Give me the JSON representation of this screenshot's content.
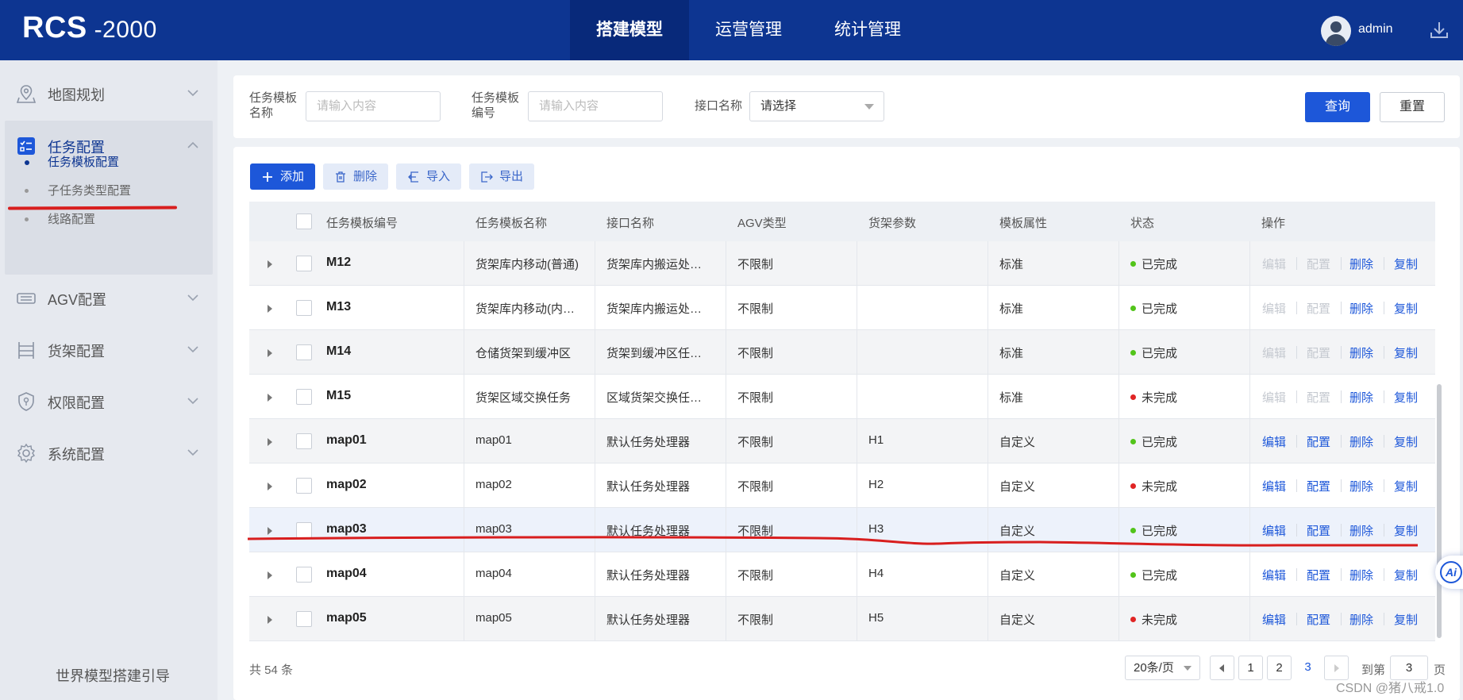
{
  "header": {
    "logo_main": "RCS",
    "logo_suffix": " -2000",
    "tabs": [
      {
        "label": "搭建模型",
        "active": true
      },
      {
        "label": "运营管理",
        "active": false
      },
      {
        "label": "统计管理",
        "active": false
      }
    ],
    "username": "admin",
    "download_icon": "download-icon"
  },
  "sidebar": {
    "items": [
      {
        "label": "地图规划",
        "icon": "map-pin-icon"
      },
      {
        "label": "任务配置",
        "icon": "task-list-icon",
        "expanded": true
      },
      {
        "label": "AGV配置",
        "icon": "agv-icon"
      },
      {
        "label": "货架配置",
        "icon": "shelf-icon"
      },
      {
        "label": "权限配置",
        "icon": "shield-icon"
      },
      {
        "label": "系统配置",
        "icon": "gear-icon"
      }
    ],
    "sub_items": [
      {
        "label": "任务模板配置",
        "active": true
      },
      {
        "label": "子任务类型配置",
        "active": false
      },
      {
        "label": "线路配置",
        "active": false
      }
    ],
    "footer": "世界模型搭建引导"
  },
  "search": {
    "template_name_label_1": "任务模板",
    "template_name_label_2": "名称",
    "template_name_placeholder": "请输入内容",
    "template_code_label_1": "任务模板",
    "template_code_label_2": "编号",
    "template_code_placeholder": "请输入内容",
    "interface_label": "接口名称",
    "interface_value": "请选择",
    "query_label": "查询",
    "reset_label": "重置"
  },
  "toolbar": {
    "add_label": "添加",
    "delete_label": "删除",
    "import_label": "导入",
    "export_label": "导出"
  },
  "table": {
    "columns": [
      "任务模板编号",
      "任务模板名称",
      "接口名称",
      "AGV类型",
      "货架参数",
      "模板属性",
      "状态",
      "操作"
    ],
    "actions": [
      "编辑",
      "配置",
      "删除",
      "复制"
    ],
    "rows": [
      {
        "code": "M12",
        "name": "货架库内移动(普通)",
        "interface": "货架库内搬运处…",
        "agv": "不限制",
        "shelf": "",
        "attr": "标准",
        "status": "已完成",
        "status_color": "#52c41a",
        "editable": false
      },
      {
        "code": "M13",
        "name": "货架库内移动(内…",
        "interface": "货架库内搬运处…",
        "agv": "不限制",
        "shelf": "",
        "attr": "标准",
        "status": "已完成",
        "status_color": "#52c41a",
        "editable": false
      },
      {
        "code": "M14",
        "name": "仓储货架到缓冲区",
        "interface": "货架到缓冲区任…",
        "agv": "不限制",
        "shelf": "",
        "attr": "标准",
        "status": "已完成",
        "status_color": "#52c41a",
        "editable": false
      },
      {
        "code": "M15",
        "name": "货架区域交换任务",
        "interface": "区域货架交换任…",
        "agv": "不限制",
        "shelf": "",
        "attr": "标准",
        "status": "未完成",
        "status_color": "#e02424",
        "editable": false
      },
      {
        "code": "map01",
        "name": "map01",
        "interface": "默认任务处理器",
        "agv": "不限制",
        "shelf": "H1",
        "attr": "自定义",
        "status": "已完成",
        "status_color": "#52c41a",
        "editable": true
      },
      {
        "code": "map02",
        "name": "map02",
        "interface": "默认任务处理器",
        "agv": "不限制",
        "shelf": "H2",
        "attr": "自定义",
        "status": "未完成",
        "status_color": "#e02424",
        "editable": true
      },
      {
        "code": "map03",
        "name": "map03",
        "interface": "默认任务处理器",
        "agv": "不限制",
        "shelf": "H3",
        "attr": "自定义",
        "status": "已完成",
        "status_color": "#52c41a",
        "editable": true
      },
      {
        "code": "map04",
        "name": "map04",
        "interface": "默认任务处理器",
        "agv": "不限制",
        "shelf": "H4",
        "attr": "自定义",
        "status": "已完成",
        "status_color": "#52c41a",
        "editable": true
      },
      {
        "code": "map05",
        "name": "map05",
        "interface": "默认任务处理器",
        "agv": "不限制",
        "shelf": "H5",
        "attr": "自定义",
        "status": "未完成",
        "status_color": "#e02424",
        "editable": true
      }
    ]
  },
  "pagination": {
    "total": "共 54 条",
    "page_size": "20条/页",
    "pages": [
      "1",
      "2",
      "3"
    ],
    "current_page": "3",
    "goto_label": "到第",
    "goto_value": "3",
    "page_suffix": "页"
  },
  "ai_button": "Ai",
  "watermark": "CSDN @猪八戒1.0",
  "colors": {
    "header_bg": "#0d3591",
    "primary": "#1d57d9",
    "status_done": "#52c41a",
    "status_undone": "#e02424"
  }
}
